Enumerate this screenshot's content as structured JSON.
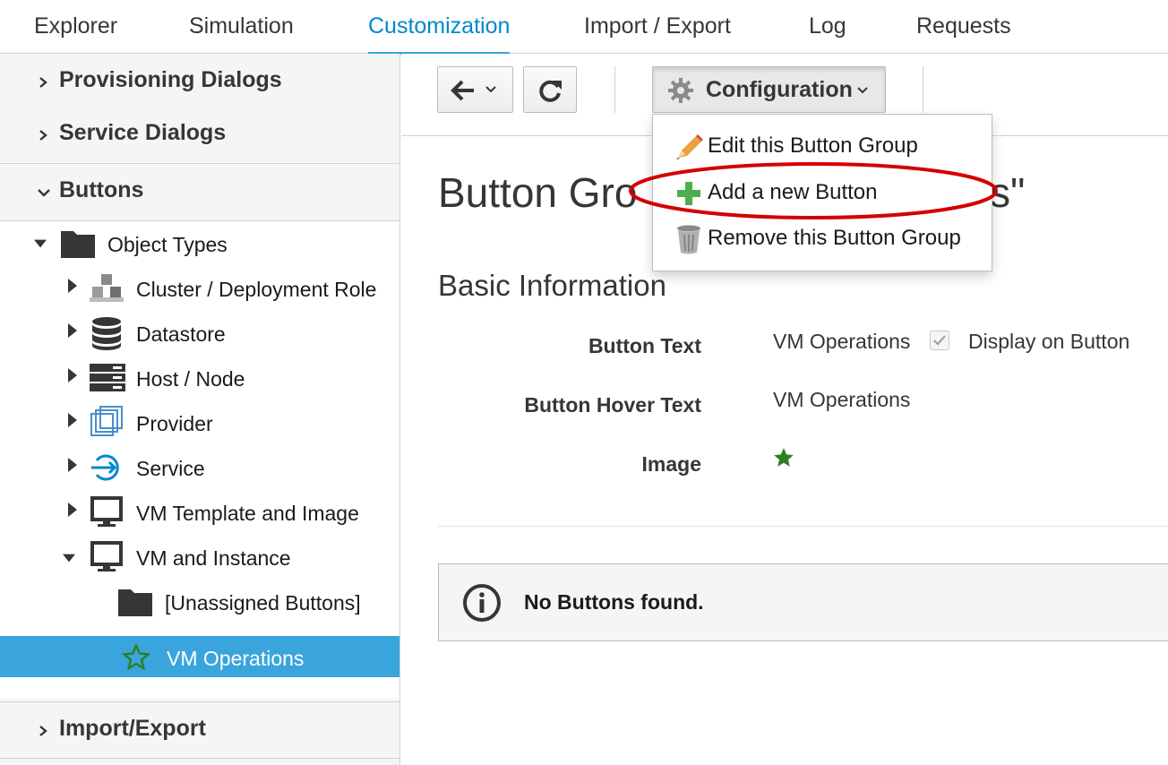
{
  "top_nav": {
    "tabs": [
      {
        "label": "Explorer"
      },
      {
        "label": "Simulation"
      },
      {
        "label": "Customization",
        "active": true
      },
      {
        "label": "Import / Export"
      },
      {
        "label": "Log"
      },
      {
        "label": "Requests"
      }
    ]
  },
  "sidebar": {
    "accordions": [
      {
        "label": "Provisioning Dialogs",
        "expanded": false
      },
      {
        "label": "Service Dialogs",
        "expanded": false
      },
      {
        "label": "Buttons",
        "expanded": true
      },
      {
        "label": "Import/Export",
        "expanded": false
      }
    ],
    "tree": {
      "root": {
        "label": "Object Types",
        "icon": "folder-icon"
      },
      "children": [
        {
          "label": "Cluster / Deployment Role",
          "icon": "cluster-icon"
        },
        {
          "label": "Datastore",
          "icon": "datastore-icon"
        },
        {
          "label": "Host / Node",
          "icon": "host-icon"
        },
        {
          "label": "Provider",
          "icon": "provider-icon"
        },
        {
          "label": "Service",
          "icon": "service-icon"
        },
        {
          "label": "VM Template and Image",
          "icon": "monitor-icon"
        },
        {
          "label": "VM and Instance",
          "icon": "monitor-icon"
        }
      ],
      "vm_children": [
        {
          "label": "[Unassigned Buttons]",
          "icon": "folder-icon"
        },
        {
          "label": "VM Operations",
          "icon": "star-icon",
          "selected": true
        }
      ]
    }
  },
  "toolbar": {
    "configuration_label": "Configuration",
    "configuration_menu": [
      {
        "label": "Edit this Button Group",
        "icon": "pencil-icon"
      },
      {
        "label": "Add a new Button",
        "icon": "plus-icon"
      },
      {
        "label": "Remove this Button Group",
        "icon": "trash-icon"
      }
    ]
  },
  "main": {
    "title_visible": "Button Gro",
    "title_tail": "s\"",
    "section_title": "Basic Information",
    "fields": [
      {
        "label": "Button Text",
        "value": "VM Operations",
        "checkbox_label": "Display on Button",
        "checkbox_checked": true
      },
      {
        "label": "Button Hover Text",
        "value": "VM Operations"
      },
      {
        "label": "Image",
        "value_icon": "star-icon"
      }
    ],
    "alert": {
      "text": "No Buttons found.",
      "icon": "info-icon"
    }
  },
  "colors": {
    "accent": "#0088ce",
    "selected_bg": "#39a5dc",
    "highlight": "#d40000",
    "star": "#3f9c35"
  }
}
